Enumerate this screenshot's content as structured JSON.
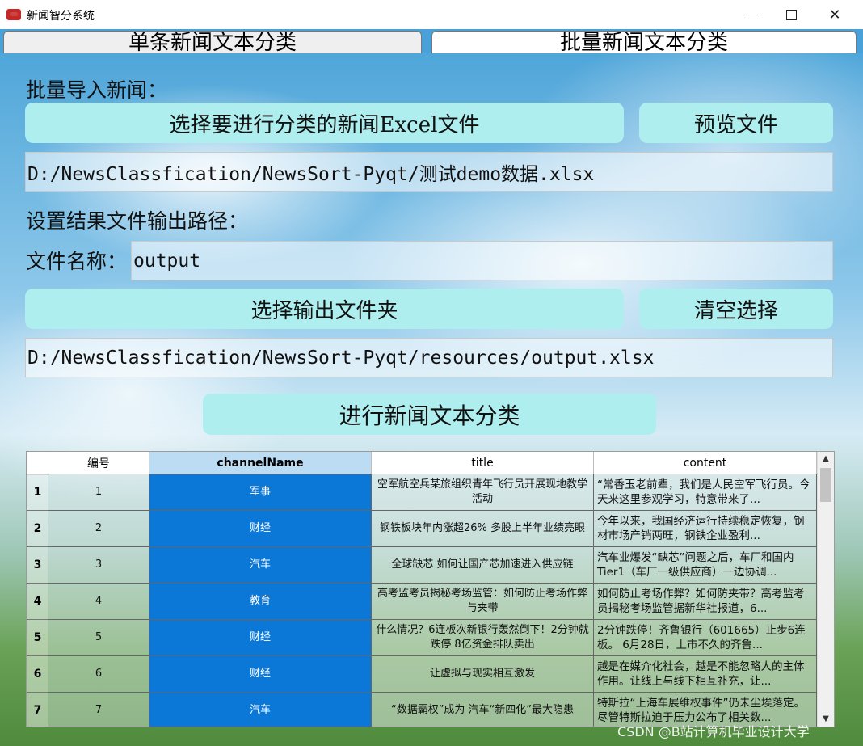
{
  "window": {
    "title": "新闻智分系统"
  },
  "tabs": [
    {
      "label": "单条新闻文本分类"
    },
    {
      "label": "批量新闻文本分类"
    }
  ],
  "batch": {
    "import_label": "批量导入新闻：",
    "choose_file_button": "选择要进行分类的新闻Excel文件",
    "preview_button": "预览文件",
    "input_path": "D:/NewsClassfication/NewsSort-Pyqt/测试demo数据.xlsx",
    "output_section_label": "设置结果文件输出路径：",
    "filename_label": "文件名称：",
    "filename_value": "output",
    "choose_folder_button": "选择输出文件夹",
    "clear_button": "清空选择",
    "output_path": "D:/NewsClassfication/NewsSort-Pyqt/resources/output.xlsx",
    "classify_button": "进行新闻文本分类"
  },
  "table": {
    "headers": [
      "编号",
      "channelName",
      "title",
      "content"
    ],
    "rows": [
      {
        "row": "1",
        "id": "1",
        "channel": "军事",
        "title": "空军航空兵某旅组织青年飞行员开展现地教学活动",
        "content": "“常香玉老前辈，我们是人民空军飞行员。今天来这里参观学习，特意带来了..."
      },
      {
        "row": "2",
        "id": "2",
        "channel": "财经",
        "title": "钢铁板块年内涨超26% 多股上半年业绩亮眼",
        "content": "今年以来，我国经济运行持续稳定恢复，钢材市场产销两旺，钢铁企业盈利..."
      },
      {
        "row": "3",
        "id": "3",
        "channel": "汽车",
        "title": "全球缺芯 如何让国产芯加速进入供应链",
        "content": "汽车业爆发“缺芯”问题之后，车厂和国内Tier1（车厂一级供应商）一边协调..."
      },
      {
        "row": "4",
        "id": "4",
        "channel": "教育",
        "title": "高考监考员揭秘考场监管：如何防止考场作弊与夹带",
        "content": "如何防止考场作弊？如何防夹带？高考监考员揭秘考场监管据新华社报道，6..."
      },
      {
        "row": "5",
        "id": "5",
        "channel": "财经",
        "title": "什么情况？6连板次新银行轰然倒下！2分钟就跌停 8亿资金排队卖出",
        "content": "2分钟跌停！齐鲁银行（601665）止步6连板。 6月28日，上市不久的齐鲁..."
      },
      {
        "row": "6",
        "id": "6",
        "channel": "财经",
        "title": "让虚拟与现实相互激发",
        "content": "越是在媒介化社会，越是不能忽略人的主体作用。让线上与线下相互补充，让..."
      },
      {
        "row": "7",
        "id": "7",
        "channel": "汽车",
        "title": "“数据霸权”成为 汽车“新四化”最大隐患",
        "content": "特斯拉“上海车展维权事件”仍未尘埃落定。尽管特斯拉迫于压力公布了相关数..."
      }
    ]
  },
  "watermark": "CSDN @B站计算机毕业设计大学"
}
